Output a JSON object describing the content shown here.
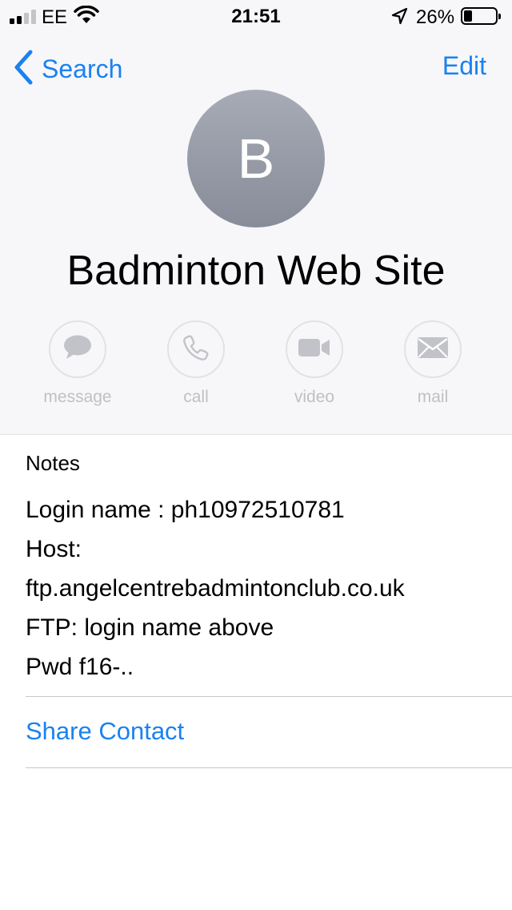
{
  "status_bar": {
    "carrier": "EE",
    "time": "21:51",
    "battery_percent": "26%",
    "battery_level": 0.26
  },
  "nav": {
    "back_label": "Search",
    "edit_label": "Edit"
  },
  "contact": {
    "initial": "B",
    "name": "Badminton Web Site"
  },
  "actions": [
    {
      "label": "message",
      "icon": "message-bubble-icon"
    },
    {
      "label": "call",
      "icon": "phone-icon"
    },
    {
      "label": "video",
      "icon": "video-camera-icon"
    },
    {
      "label": "mail",
      "icon": "envelope-icon"
    }
  ],
  "notes": {
    "title": "Notes",
    "lines": [
      "Login name : ph10972510781",
      "Host:",
      "ftp.angelcentrebadmintonclub.co.uk",
      "FTP: login name above",
      "Pwd f16-.."
    ]
  },
  "share_contact_label": "Share Contact",
  "colors": {
    "accent": "#1a82f0",
    "action_disabled": "#bfc0c5",
    "header_bg": "#f7f7f9"
  }
}
